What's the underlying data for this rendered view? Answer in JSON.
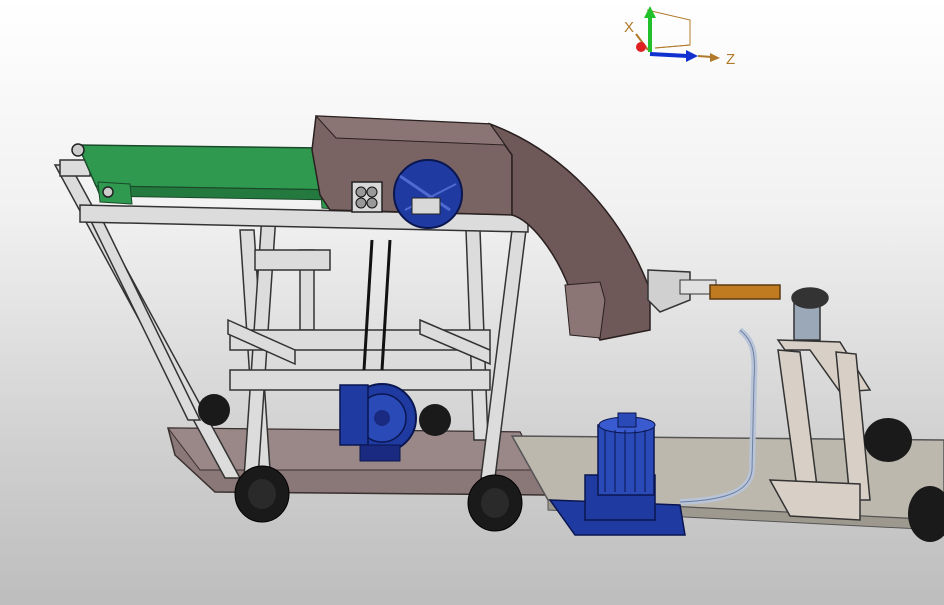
{
  "view": {
    "background_top": "#ffffff",
    "background_bottom": "#bdbdbd"
  },
  "triad": {
    "x_label": "X",
    "z_label": "Z",
    "x_color": "#b07a2a",
    "y_color": "#22c02a",
    "z_color": "#1030d0"
  },
  "model": {
    "frame_color": "#d8d8d8",
    "housing_color": "#7a6363",
    "belt_color": "#2f9a4f",
    "motor_color": "#1f3aa0",
    "wheel_color": "#1a1a1a",
    "handle_color": "#c07a20",
    "platform_color": "#bdb8ae"
  }
}
